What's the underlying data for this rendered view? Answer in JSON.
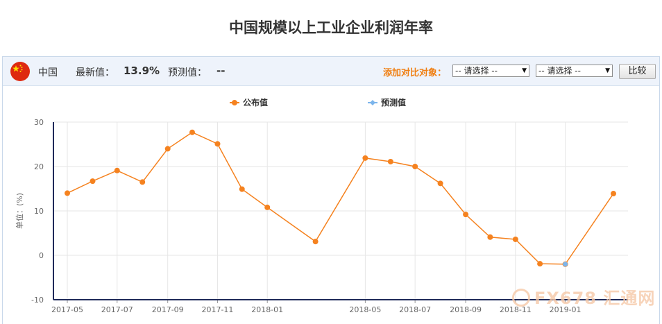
{
  "header": {
    "title": "中国规模以上工业企业利润年率"
  },
  "indicator": {
    "country": "中国",
    "latest_label": "最新值：",
    "latest_value": "13.9%",
    "forecast_label": "预测值：",
    "forecast_value": "--"
  },
  "compare": {
    "label": "添加对比对象：",
    "select1_value": "-- 请选择 --",
    "select2_value": "-- 请选择 --",
    "button_label": "比较"
  },
  "watermark": "FX678 汇通网",
  "colors": {
    "published": "#f5821f",
    "forecast": "#7cb5ec",
    "axis": "#1f2a5a",
    "grid": "#e6e6e6"
  },
  "chart_data": {
    "type": "line",
    "ylabel": "单位：(%)",
    "ylim": [
      -10,
      30
    ],
    "yticks": [
      -10,
      0,
      10,
      20,
      30
    ],
    "x_tick_labels": [
      "2017-05",
      "2017-07",
      "2017-09",
      "2017-11",
      "2018-01",
      "2018-05",
      "2018-07",
      "2018-09",
      "2018-11",
      "2019-01"
    ],
    "x": [
      "2017-05",
      "2017-06",
      "2017-07",
      "2017-08",
      "2017-09",
      "2017-10",
      "2017-11",
      "2017-12",
      "2018-01",
      "2018-03",
      "2018-05",
      "2018-06",
      "2018-07",
      "2018-08",
      "2018-09",
      "2018-10",
      "2018-11",
      "2018-12",
      "2019-01",
      "2019-03"
    ],
    "legend_position": "top",
    "series": [
      {
        "name": "公布值",
        "color": "#f5821f",
        "values": [
          14.0,
          16.7,
          19.1,
          16.5,
          24.0,
          27.7,
          25.1,
          14.9,
          10.8,
          3.1,
          21.9,
          21.1,
          20.0,
          16.2,
          9.2,
          4.1,
          3.6,
          -1.9,
          -2.0,
          13.9
        ]
      },
      {
        "name": "预测值",
        "color": "#7cb5ec",
        "values": [
          null,
          null,
          null,
          null,
          null,
          null,
          null,
          null,
          null,
          null,
          null,
          null,
          null,
          null,
          null,
          null,
          null,
          null,
          -2.0,
          null
        ]
      }
    ]
  }
}
